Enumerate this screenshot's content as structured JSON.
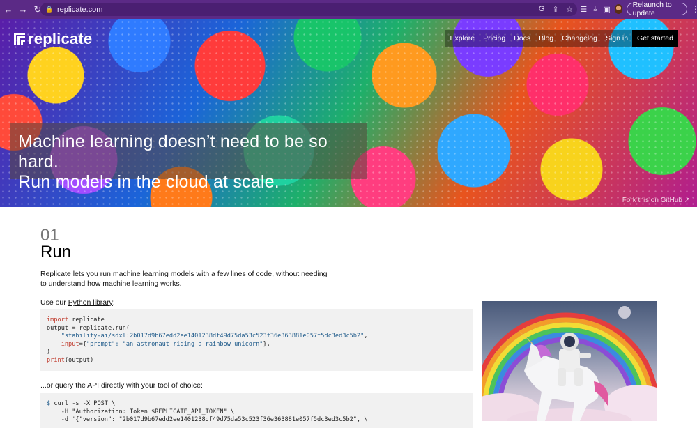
{
  "browser": {
    "url": "replicate.com",
    "relaunch_label": "Relaunch to update"
  },
  "brand": {
    "name": "replicate"
  },
  "nav": {
    "items": [
      "Explore",
      "Pricing",
      "Docs",
      "Blog",
      "Changelog",
      "Sign in"
    ],
    "cta": "Get started"
  },
  "hero": {
    "line1": "Machine learning doesn’t need to be so hard.",
    "line2": "Run models in the cloud at scale.",
    "fork_link": "Fork this on GitHub ↗"
  },
  "section": {
    "number": "01",
    "title": "Run",
    "intro": "Replicate lets you run machine learning models with a few lines of code, without needing to understand how machine learning works.",
    "use_prefix": "Use our ",
    "use_link": "Python library",
    "use_suffix": ":",
    "query_text": "...or query the API directly with your tool of choice:"
  },
  "code_python": {
    "l1_kw": "import",
    "l1_rest": " replicate",
    "l2": "output = replicate.run(",
    "l3_str": "\"stability-ai/sdxl:2b017d9b67edd2ee1401238df49d75da53c523f36e363881e057f5dc3ed3c5b2\"",
    "l3_end": ",",
    "l4_kw": "input",
    "l4_rest": "={",
    "l4_str": "\"prompt\": \"an astronaut riding a rainbow unicorn\"",
    "l4_end": "},",
    "l5": ")",
    "l6_kw": "print",
    "l6_rest": "(output)"
  },
  "code_curl": {
    "l1_prompt": "$",
    "l1": " curl -s -X POST \\",
    "l2": "  -H \"Authorization: Token $REPLICATE_API_TOKEN\" \\",
    "l3": "  -d '{\"version\": \"2b017d9b67edd2ee1401238df49d75da53c523f36e363881e057f5dc3ed3c5b2\", \\"
  }
}
